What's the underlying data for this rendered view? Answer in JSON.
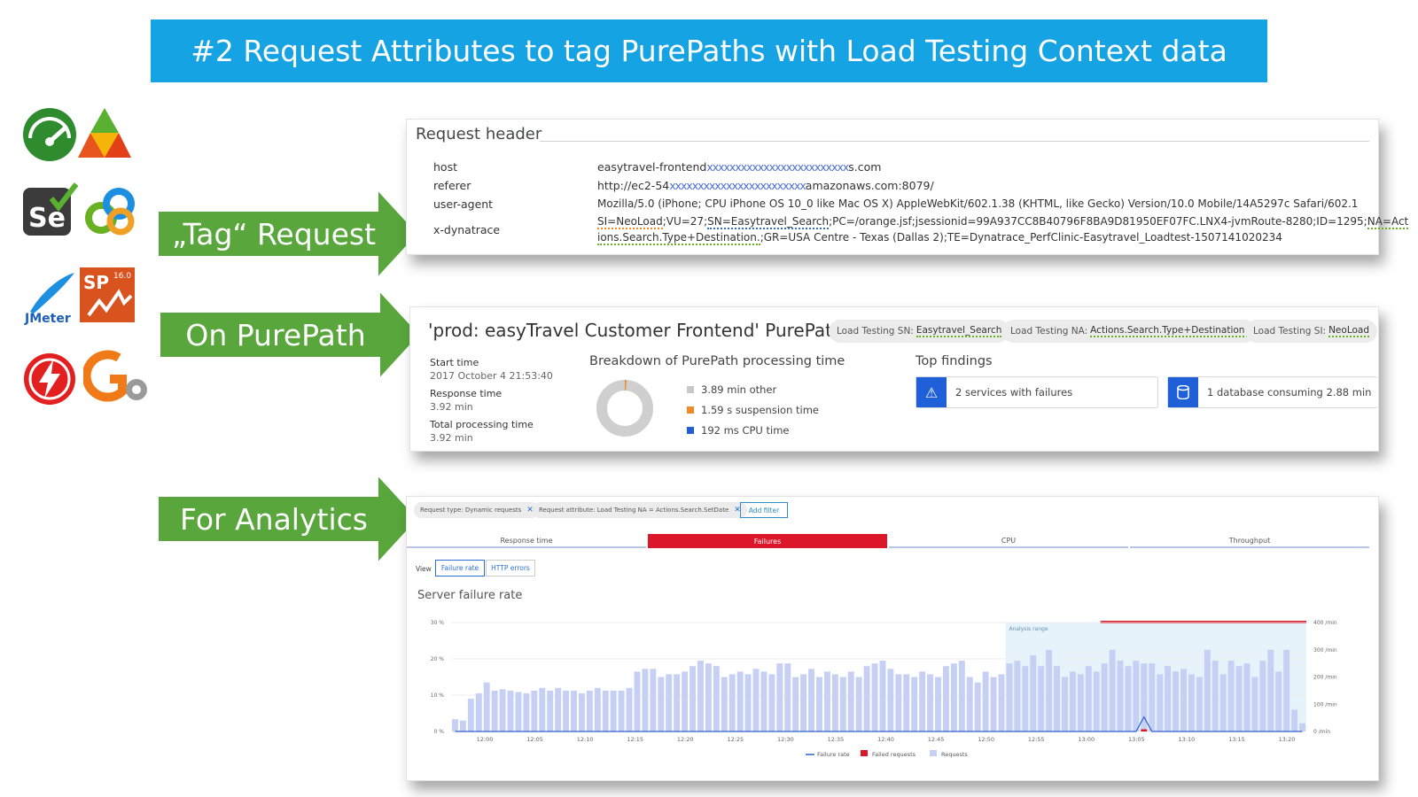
{
  "banner": {
    "title": "#2 Request Attributes to tag PurePaths with Load Testing Context data"
  },
  "logos": [
    "speedometer-logo",
    "triangle-logo",
    "selenium-logo",
    "chain-logo",
    "jmeter-logo",
    "silkperformer-logo",
    "lightning-logo",
    "gatling-logo"
  ],
  "logo_text": {
    "jmeter": "JMeter",
    "sp": "SP",
    "sp_version": "16.0",
    "se": "Se"
  },
  "arrows": {
    "tag": "„Tag“ Request",
    "purepath": "On PurePath",
    "analytics": "For Analytics"
  },
  "colors": {
    "banner": "#16a3e3",
    "arrow": "#58a63c",
    "failures": "#dc172a",
    "requests": "#c6d0f4",
    "failure_rate": "#2d5fd0"
  },
  "request_header": {
    "title": "Request header",
    "rows": [
      {
        "key": "host",
        "value_pre": "easytravel-frontend",
        "value_mask": "xxxxxxxxxxxxxxxxxxxxxxxxx",
        "value_post": "s.com"
      },
      {
        "key": "referer",
        "value_pre": "http://ec2-54",
        "value_mask": "xxxxxxxxxxxxxxxxxxxxxxxx",
        "value_post": "amazonaws.com:8079/"
      },
      {
        "key": "user-agent",
        "value": "Mozilla/5.0 (iPhone; CPU iPhone OS 10_0 like Mac OS X) AppleWebKit/602.1.38 (KHTML, like Gecko) Version/10.0 Mobile/14A5297c Safari/602.1"
      },
      {
        "key": "x-dynatrace",
        "line1_a": "SI=NeoLoad",
        "line1_b": ";VU=27;",
        "line1_c": "SN=Easytravel_Search",
        "line1_d": ";PC=/orange.jsf;jsessionid=99A937CC8B40796F8BA9D81950EF07FC.LNX4-jvmRoute-8280;ID=1295;",
        "line1_e": "NA=Act",
        "line2_a": "ions.Search.Type+Destination.",
        "line2_b": ";GR=USA Centre - Texas (Dallas 2);TE=Dynatrace_PerfClinic-Easytravel_Loadtest-1507141020234"
      }
    ]
  },
  "purepath": {
    "title": "'prod: easyTravel Customer Frontend' PurePath",
    "tags": [
      {
        "label": "Load Testing SN:",
        "value": "Easytravel_Search"
      },
      {
        "label": "Load Testing NA:",
        "value": "Actions.Search.Type+Destination."
      },
      {
        "label": "Load Testing SI:",
        "value": "NeoLoad"
      }
    ],
    "start_time_label": "Start time",
    "start_time": "2017 October 4 21:53:40",
    "response_time_label": "Response time",
    "response_time": "3.92 min",
    "total_processing_label": "Total processing time",
    "total_processing": "3.92 min",
    "breakdown_title": "Breakdown of PurePath processing time",
    "breakdown": [
      {
        "label": "3.89 min other",
        "color": "#c8c8c8"
      },
      {
        "label": "1.59 s suspension time",
        "color": "#f08a24"
      },
      {
        "label": "192 ms CPU time",
        "color": "#1f5fd8"
      }
    ],
    "findings_title": "Top findings",
    "findings": [
      {
        "icon": "warning-icon",
        "text": "2 services with failures"
      },
      {
        "icon": "database-icon",
        "text": "1 database consuming 2.88 min"
      }
    ]
  },
  "analytics": {
    "filters": [
      {
        "label": "Request type: Dynamic requests"
      },
      {
        "label": "Request attribute: Load Testing NA = Actions.Search.SetDate"
      }
    ],
    "add_filter": "Add filter",
    "tabs": [
      "Response time",
      "Failures",
      "CPU",
      "Throughput"
    ],
    "active_tab": "Failures",
    "view_label": "View",
    "view_buttons": [
      "Failure rate",
      "HTTP errors"
    ],
    "chart_title": "Server failure rate"
  },
  "chart_data": {
    "type": "bar",
    "title": "Server failure rate",
    "x_tick_labels": [
      "12:00",
      "12:05",
      "12:10",
      "12:15",
      "12:20",
      "12:25",
      "12:30",
      "12:35",
      "12:40",
      "12:45",
      "12:50",
      "12:55",
      "13:00",
      "13:05",
      "13:10",
      "13:15",
      "13:20"
    ],
    "y_left_ticks": [
      "0 %",
      "10 %",
      "20 %",
      "30 %"
    ],
    "y_left_range": [
      0,
      30
    ],
    "y_right_ticks": [
      "0 /min",
      "100 /min",
      "200 /min",
      "300 /min",
      "400 /min"
    ],
    "y_right_range": [
      0,
      400
    ],
    "annotation": "Analysis range",
    "legend": [
      "Failure rate",
      "Failed requests",
      "Requests"
    ],
    "series": [
      {
        "name": "Requests",
        "axis": "right",
        "values": [
          45,
          40,
          120,
          140,
          180,
          150,
          155,
          150,
          145,
          140,
          150,
          160,
          150,
          160,
          150,
          150,
          140,
          150,
          160,
          150,
          150,
          150,
          160,
          220,
          230,
          230,
          200,
          210,
          210,
          220,
          240,
          260,
          250,
          240,
          200,
          210,
          220,
          210,
          230,
          220,
          210,
          250,
          250,
          200,
          210,
          230,
          200,
          220,
          210,
          200,
          220,
          200,
          240,
          250,
          260,
          230,
          210,
          210,
          200,
          220,
          210,
          200,
          240,
          250,
          260,
          200,
          180,
          220,
          200,
          210,
          250,
          260,
          240,
          280,
          240,
          300,
          240,
          200,
          220,
          210,
          240,
          220,
          250,
          300,
          260,
          240,
          260,
          250,
          250,
          210,
          240,
          220,
          230,
          210,
          200,
          300,
          260,
          210,
          260,
          240,
          250,
          200,
          260,
          300,
          220,
          300,
          80,
          30
        ]
      },
      {
        "name": "Failed requests",
        "axis": "right",
        "values": [
          0,
          0,
          0,
          0,
          0,
          0,
          0,
          0,
          0,
          0,
          0,
          0,
          0,
          0,
          0,
          0,
          0,
          0,
          0,
          0,
          0,
          0,
          0,
          0,
          0,
          0,
          0,
          0,
          0,
          0,
          0,
          0,
          0,
          0,
          0,
          0,
          0,
          0,
          0,
          0,
          0,
          0,
          0,
          0,
          0,
          0,
          0,
          0,
          0,
          0,
          0,
          0,
          0,
          0,
          0,
          0,
          0,
          0,
          0,
          0,
          0,
          0,
          0,
          0,
          0,
          0,
          0,
          0,
          0,
          0,
          0,
          0,
          0,
          0,
          0,
          0,
          0,
          0,
          0,
          0,
          0,
          0,
          0,
          0,
          0,
          0,
          0,
          8,
          0,
          0,
          0,
          0,
          0,
          0,
          0,
          0,
          0,
          0,
          0,
          0,
          0,
          0,
          0,
          0,
          0,
          0,
          0,
          0
        ]
      },
      {
        "name": "Failure rate",
        "axis": "left",
        "values": [
          0,
          0,
          0,
          0,
          0,
          0,
          0,
          0,
          0,
          0,
          0,
          0,
          0,
          0,
          0,
          0,
          0,
          0,
          0,
          0,
          0,
          0,
          0,
          0,
          0,
          0,
          0,
          0,
          0,
          0,
          0,
          0,
          0,
          0,
          0,
          0,
          0,
          0,
          0,
          0,
          0,
          0,
          0,
          0,
          0,
          0,
          0,
          0,
          0,
          0,
          0,
          0,
          0,
          0,
          0,
          0,
          0,
          0,
          0,
          0,
          0,
          0,
          0,
          0,
          0,
          0,
          0,
          0,
          0,
          0,
          0,
          0,
          0,
          0,
          0,
          0,
          0,
          0,
          0,
          0,
          0,
          0,
          0,
          0,
          0,
          0,
          0,
          4,
          0,
          0,
          0,
          0,
          0,
          0,
          0,
          0,
          0,
          0,
          0,
          0,
          0,
          0,
          0,
          0,
          0,
          0,
          0,
          0
        ]
      }
    ]
  }
}
